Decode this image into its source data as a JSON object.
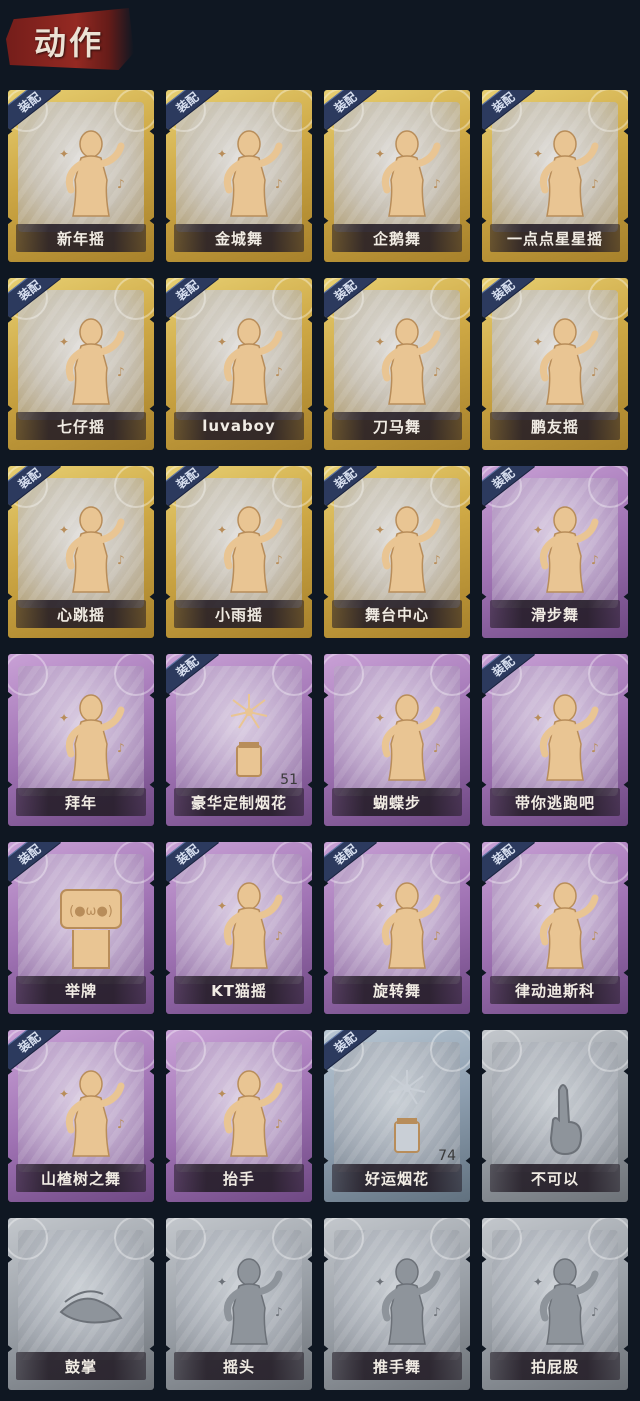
{
  "header": {
    "title": "动作"
  },
  "equip_label": "装配",
  "colors": {
    "gold": "#cda744",
    "purple": "#9f72b3",
    "silver_blue": "#8e9fb0",
    "gray": "#9aa0a7",
    "equip_tag": "#2c3a5e",
    "background": "#0f1722"
  },
  "emotes": [
    {
      "name": "新年摇",
      "tier": "gold",
      "equipped": true,
      "icon": "dance-figure-icon",
      "count": ""
    },
    {
      "name": "金城舞",
      "tier": "gold",
      "equipped": true,
      "icon": "dance-figure-icon",
      "count": ""
    },
    {
      "name": "企鹅舞",
      "tier": "gold",
      "equipped": true,
      "icon": "dance-figure-icon",
      "count": ""
    },
    {
      "name": "一点点星星摇",
      "tier": "gold",
      "equipped": true,
      "icon": "dance-figure-icon",
      "count": ""
    },
    {
      "name": "七仔摇",
      "tier": "gold",
      "equipped": true,
      "icon": "dance-figure-icon",
      "count": ""
    },
    {
      "name": "luvaboy",
      "tier": "gold",
      "equipped": true,
      "icon": "dance-figure-icon",
      "count": ""
    },
    {
      "name": "刀马舞",
      "tier": "gold",
      "equipped": true,
      "icon": "dance-figure-icon",
      "count": ""
    },
    {
      "name": "鹏友摇",
      "tier": "gold",
      "equipped": true,
      "icon": "dance-figure-icon",
      "count": ""
    },
    {
      "name": "心跳摇",
      "tier": "gold",
      "equipped": true,
      "icon": "dance-figure-icon",
      "count": ""
    },
    {
      "name": "小雨摇",
      "tier": "gold",
      "equipped": true,
      "icon": "dance-figure-icon",
      "count": ""
    },
    {
      "name": "舞台中心",
      "tier": "gold",
      "equipped": true,
      "icon": "dance-figure-icon",
      "count": ""
    },
    {
      "name": "滑步舞",
      "tier": "purple",
      "equipped": true,
      "icon": "dance-figure-icon",
      "count": ""
    },
    {
      "name": "拜年",
      "tier": "purple",
      "equipped": false,
      "icon": "bow-figure-icon",
      "count": ""
    },
    {
      "name": "豪华定制烟花",
      "tier": "purple",
      "equipped": true,
      "icon": "fireworks-icon",
      "count": "51"
    },
    {
      "name": "蝴蝶步",
      "tier": "purple",
      "equipped": false,
      "icon": "dance-figure-icon",
      "count": ""
    },
    {
      "name": "带你逃跑吧",
      "tier": "purple",
      "equipped": true,
      "icon": "dance-figure-icon",
      "count": ""
    },
    {
      "name": "举牌",
      "tier": "purple",
      "equipped": true,
      "icon": "sign-figure-icon",
      "count": ""
    },
    {
      "name": "KT猫摇",
      "tier": "purple",
      "equipped": true,
      "icon": "dance-figure-icon",
      "count": ""
    },
    {
      "name": "旋转舞",
      "tier": "purple",
      "equipped": true,
      "icon": "dance-figure-icon",
      "count": ""
    },
    {
      "name": "律动迪斯科",
      "tier": "purple",
      "equipped": true,
      "icon": "dance-figure-icon",
      "count": ""
    },
    {
      "name": "山楂树之舞",
      "tier": "purple",
      "equipped": true,
      "icon": "dance-figure-icon",
      "count": ""
    },
    {
      "name": "抬手",
      "tier": "purple",
      "equipped": false,
      "icon": "raise-hand-figure-icon",
      "count": ""
    },
    {
      "name": "好运烟花",
      "tier": "silver-blue",
      "equipped": true,
      "icon": "fireworks-icon",
      "count": "74"
    },
    {
      "name": "不可以",
      "tier": "gray",
      "equipped": false,
      "icon": "finger-wag-icon",
      "count": ""
    },
    {
      "name": "鼓掌",
      "tier": "gray",
      "equipped": false,
      "icon": "clap-hands-icon",
      "count": ""
    },
    {
      "name": "摇头",
      "tier": "gray",
      "equipped": false,
      "icon": "shake-head-figure-icon",
      "count": ""
    },
    {
      "name": "推手舞",
      "tier": "gray",
      "equipped": false,
      "icon": "dance-figure-icon",
      "count": ""
    },
    {
      "name": "拍屁股",
      "tier": "gray",
      "equipped": false,
      "icon": "dance-figure-icon",
      "count": ""
    }
  ]
}
